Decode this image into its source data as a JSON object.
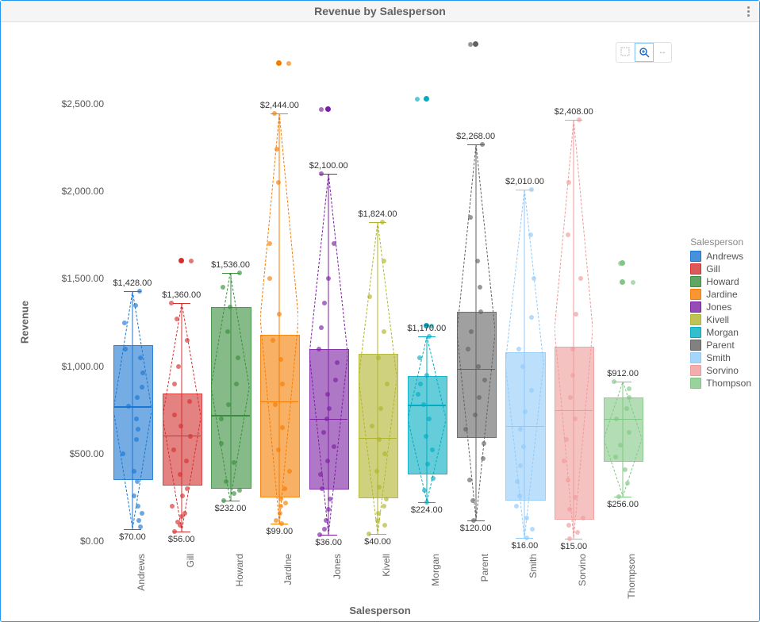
{
  "title": "Revenue by Salesperson",
  "y_axis_title": "Revenue",
  "x_axis_title": "Salesperson",
  "legend_title": "Salesperson",
  "y_ticks": [
    {
      "value": 0,
      "label": "$0.00"
    },
    {
      "value": 500,
      "label": "$500.00"
    },
    {
      "value": 1000,
      "label": "$1,000.00"
    },
    {
      "value": 1500,
      "label": "$1,500.00"
    },
    {
      "value": 2000,
      "label": "$2,000.00"
    },
    {
      "value": 2500,
      "label": "$2,500.00"
    }
  ],
  "chart_data": {
    "type": "boxplot",
    "ylim": [
      -50,
      2900
    ],
    "series": [
      {
        "name": "Andrews",
        "color": "#1976d2",
        "min": 70,
        "q1": 360,
        "median": 770,
        "q3": 1120,
        "max": 1428,
        "min_label": "$70.00",
        "max_label": "$1,428.00",
        "jitter": [
          80,
          120,
          160,
          200,
          260,
          340,
          400,
          500,
          580,
          640,
          700,
          770,
          820,
          880,
          960,
          1050,
          1100,
          1250,
          1350,
          1428
        ],
        "outliers": []
      },
      {
        "name": "Gill",
        "color": "#d32f2f",
        "min": 56,
        "q1": 325,
        "median": 605,
        "q3": 845,
        "max": 1360,
        "min_label": "$56.00",
        "max_label": "$1,360.00",
        "jitter": [
          56,
          90,
          110,
          140,
          160,
          200,
          260,
          300,
          380,
          460,
          520,
          600,
          660,
          720,
          800,
          900,
          1000,
          1150,
          1270,
          1360,
          1600
        ],
        "outliers": [
          1600
        ]
      },
      {
        "name": "Howard",
        "color": "#388e3c",
        "min": 232,
        "q1": 310,
        "median": 720,
        "q3": 1340,
        "max": 1536,
        "min_label": "$232.00",
        "max_label": "$1,536.00",
        "jitter": [
          232,
          270,
          290,
          340,
          450,
          560,
          700,
          780,
          900,
          1050,
          1200,
          1340,
          1450,
          1536
        ],
        "outliers": []
      },
      {
        "name": "Jardine",
        "color": "#f57c00",
        "min": 99,
        "q1": 260,
        "median": 800,
        "q3": 1180,
        "max": 2444,
        "min_label": "$99.00",
        "max_label": "$2,444.00",
        "jitter": [
          99,
          120,
          160,
          200,
          220,
          240,
          300,
          400,
          520,
          650,
          780,
          900,
          1040,
          1150,
          1300,
          1500,
          1700,
          2050,
          2240,
          2444,
          2730
        ],
        "outliers": [
          2730
        ]
      },
      {
        "name": "Jones",
        "color": "#7b1fa2",
        "min": 36,
        "q1": 305,
        "median": 700,
        "q3": 1100,
        "max": 2100,
        "min_label": "$36.00",
        "max_label": "$2,100.00",
        "jitter": [
          36,
          70,
          120,
          180,
          240,
          300,
          380,
          460,
          540,
          620,
          700,
          760,
          840,
          920,
          1020,
          1100,
          1220,
          1360,
          1500,
          1700,
          2100,
          2470
        ],
        "outliers": [
          2470
        ]
      },
      {
        "name": "Kivell",
        "color": "#afb42b",
        "min": 40,
        "q1": 255,
        "median": 590,
        "q3": 1070,
        "max": 1824,
        "min_label": "$40.00",
        "max_label": "$1,824.00",
        "jitter": [
          40,
          90,
          120,
          160,
          200,
          240,
          310,
          400,
          500,
          580,
          660,
          760,
          900,
          1050,
          1200,
          1400,
          1600,
          1824
        ],
        "outliers": []
      },
      {
        "name": "Morgan",
        "color": "#00acc1",
        "min": 224,
        "q1": 390,
        "median": 780,
        "q3": 945,
        "max": 1170,
        "min_label": "$224.00",
        "max_label": "$1,170.00",
        "jitter": [
          224,
          290,
          360,
          440,
          520,
          600,
          700,
          780,
          840,
          900,
          950,
          1050,
          1170,
          1230,
          2530
        ],
        "outliers": [
          1230,
          2530
        ]
      },
      {
        "name": "Parent",
        "color": "#616161",
        "min": 120,
        "q1": 600,
        "median": 985,
        "q3": 1310,
        "max": 2268,
        "min_label": "$120.00",
        "max_label": "$2,268.00",
        "jitter": [
          120,
          230,
          350,
          470,
          560,
          640,
          720,
          820,
          920,
          1000,
          1100,
          1200,
          1310,
          1450,
          1600,
          1850,
          2268,
          2840
        ],
        "outliers": [
          2840
        ]
      },
      {
        "name": "Smith",
        "color": "#90caf9",
        "min": 16,
        "q1": 240,
        "median": 660,
        "q3": 1080,
        "max": 2010,
        "min_label": "$16.00",
        "max_label": "$2,010.00",
        "jitter": [
          16,
          70,
          130,
          200,
          260,
          340,
          430,
          540,
          640,
          740,
          860,
          1000,
          1100,
          1280,
          1500,
          1750,
          2010
        ],
        "outliers": []
      },
      {
        "name": "Sorvino",
        "color": "#ef9a9a",
        "min": 15,
        "q1": 130,
        "median": 750,
        "q3": 1110,
        "max": 2408,
        "min_label": "$15.00",
        "max_label": "$2,408.00",
        "jitter": [
          15,
          50,
          90,
          130,
          180,
          250,
          350,
          460,
          580,
          700,
          820,
          950,
          1100,
          1300,
          1500,
          1750,
          2050,
          2408
        ],
        "outliers": []
      },
      {
        "name": "Thompson",
        "color": "#81c784",
        "min": 256,
        "q1": 465,
        "median": 700,
        "q3": 820,
        "max": 912,
        "min_label": "$256.00",
        "max_label": "$912.00",
        "jitter": [
          256,
          330,
          410,
          480,
          550,
          620,
          700,
          760,
          820,
          870,
          912,
          1480,
          1590
        ],
        "outliers": [
          1480,
          1590
        ]
      }
    ]
  },
  "toolbar": {
    "tools": [
      {
        "name": "marquee-select-icon",
        "active": false
      },
      {
        "name": "zoom-icon",
        "active": true
      },
      {
        "name": "pan-icon",
        "active": false
      }
    ]
  }
}
